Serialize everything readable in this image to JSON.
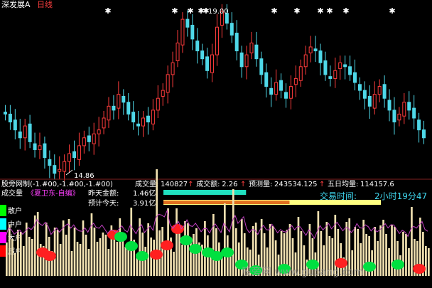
{
  "header": {
    "title": "深发展A",
    "period": "日线",
    "high_price_label": "19.00",
    "low_price_label": "14.86"
  },
  "indicator_line": {
    "prefix": "股旁网制(-1.#00,-1.#00,-1.#00)",
    "items": [
      {
        "label": "成交量:",
        "value": "140827"
      },
      {
        "label": "成交额:",
        "value": "2.26"
      },
      {
        "label": "预测量:",
        "value": "243534.125"
      },
      {
        "label": "五日均量:",
        "value": "114157.6"
      }
    ]
  },
  "volume_panel": {
    "title": "成交量",
    "source": "《夏卫东-自编》",
    "yesterday_label": "昨天金额:",
    "yesterday_value": "1.46亿",
    "today_label": "预计今天:",
    "today_value": "3.91亿",
    "trade_time_label": "交易时间:",
    "trade_time_value": "2小时19分47",
    "yesterday_fraction": 0.37,
    "today_fraction": 1.0,
    "legend": [
      {
        "label": "散户",
        "color": "#00ff00"
      },
      {
        "label": "中户",
        "color": "#00ffff"
      },
      {
        "label": "大户",
        "color": "#ff00ff"
      },
      {
        "label": "超户",
        "color": "#ff0000"
      }
    ]
  },
  "watermark": "股旁网 www.gupang.com",
  "colors": {
    "up": "#ff3c3c",
    "down": "#4fd8e8",
    "text_yellow": "#ffff00",
    "text_white": "#ffffff",
    "text_cyan": "#40d8f0",
    "bar_cyan": "#20e0c0",
    "bar_orange": "#e07020",
    "volume_bar": "#f0e0b0",
    "ribbon_green": "#00e040",
    "ribbon_red": "#ff2020",
    "ma_line": "#c040c0"
  },
  "chart_data": [
    {
      "type": "candlestick",
      "series_name": "深发展A",
      "y_range": [
        14.86,
        19.0
      ],
      "close_series_approx": [
        16.4,
        16.2,
        16.0,
        15.8,
        16.1,
        15.7,
        15.5,
        15.6,
        15.3,
        15.1,
        14.9,
        15.0,
        15.2,
        15.4,
        15.3,
        15.6,
        15.8,
        15.7,
        15.9,
        16.0,
        16.3,
        16.6,
        16.5,
        16.9,
        16.7,
        16.4,
        16.2,
        16.1,
        16.3,
        16.2,
        16.5,
        16.8,
        17.0,
        17.4,
        17.7,
        18.2,
        18.8,
        18.6,
        18.3,
        18.0,
        17.8,
        17.5,
        17.9,
        18.6,
        19.0,
        18.7,
        18.4,
        18.0,
        17.6,
        17.9,
        18.2,
        17.8,
        17.4,
        17.1,
        16.9,
        17.2,
        17.0,
        16.8,
        17.1,
        17.3,
        17.6,
        17.9,
        18.1,
        18.0,
        17.7,
        17.4,
        17.3,
        17.5,
        17.7,
        17.6,
        17.4,
        17.2,
        17.0,
        16.8,
        16.6,
        16.9,
        17.1,
        16.8,
        16.5,
        16.2,
        16.4,
        16.7,
        16.5,
        16.3,
        16.0,
        15.8
      ]
    },
    {
      "type": "bar",
      "series_name": "成交量",
      "values": [
        140827
      ]
    }
  ]
}
